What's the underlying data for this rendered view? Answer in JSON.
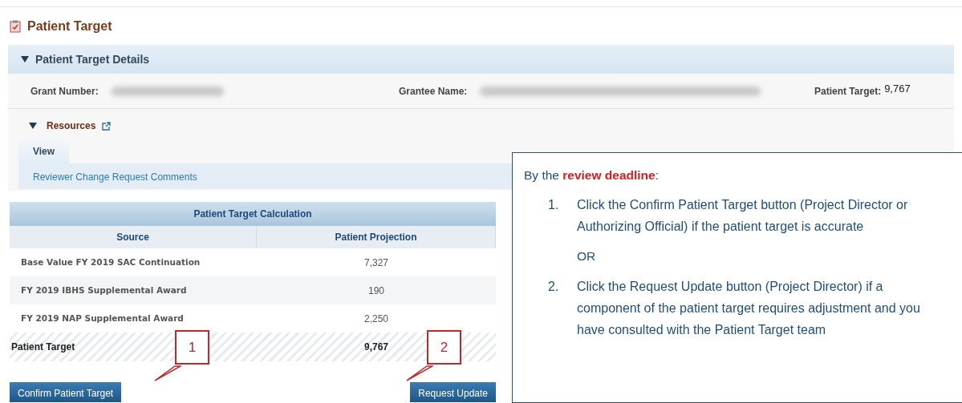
{
  "page_title": "Patient Target",
  "details": {
    "title": "Patient Target Details",
    "expanded": true,
    "fields": [
      {
        "label": "Grant Number:",
        "redacted": true
      },
      {
        "label": "Grantee Name:",
        "redacted": true
      },
      {
        "label": "Patient Target:",
        "value": "9,767"
      }
    ]
  },
  "resources": {
    "title": "Resources",
    "expanded": true,
    "tab": "View",
    "link": "Reviewer Change Request Comments"
  },
  "calculation": {
    "title": "Patient Target Calculation",
    "columns": [
      "Source",
      "Patient Projection"
    ],
    "rows": [
      {
        "source": "Base Value FY 2019 SAC Continuation",
        "projection": "7,327",
        "kind": "item"
      },
      {
        "source": "FY 2019 IBHS Supplemental Award",
        "projection": "190",
        "kind": "item"
      },
      {
        "source": "FY 2019 NAP Supplemental Award",
        "projection": "2,250",
        "kind": "item"
      },
      {
        "source": "Patient Target",
        "projection": "9,767",
        "kind": "total"
      }
    ]
  },
  "buttons": [
    "Confirm Patient Target",
    "Request Update"
  ],
  "callout_numbers": [
    "1",
    "2"
  ],
  "instructions": {
    "intro": "By the **review deadline**:",
    "steps": [
      {
        "number": "1.",
        "text": "Click the Confirm Patient Target button (Project Director or Authorizing Official) if the patient target is accurate"
      },
      {
        "number": "2.",
        "text": "Click the Request Update button (Project Director) if a component of the patient target requires adjustment and you have consulted with the Patient Target team"
      }
    ],
    "separator": "OR"
  }
}
